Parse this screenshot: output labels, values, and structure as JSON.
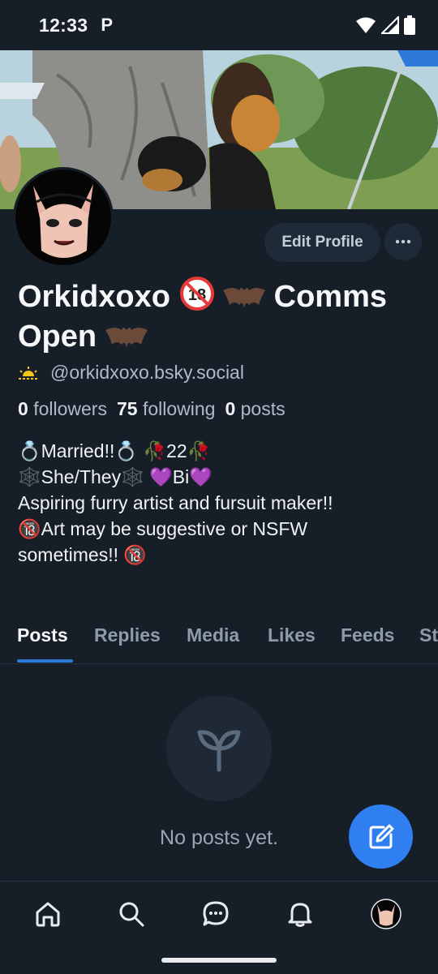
{
  "status_bar": {
    "time": "12:33",
    "notification": "P"
  },
  "profile": {
    "display_name_part1": "Orkidxoxo",
    "display_name_part2": "Comms",
    "display_name_part3": "Open",
    "handle": "@orkidxoxo.bsky.social",
    "followers_count": "0",
    "followers_label": "followers",
    "following_count": "75",
    "following_label": "following",
    "posts_count": "0",
    "posts_label": "posts",
    "bio_lines": [
      "💍Married!!💍 🥀22🥀",
      "🕸️She/They🕸️ 💜Bi💜",
      "Aspiring furry artist and fursuit maker!!",
      "🔞Art may be suggestive or NSFW",
      "sometimes!! 🔞"
    ]
  },
  "actions": {
    "edit_profile": "Edit Profile",
    "more": "···"
  },
  "tabs": [
    "Posts",
    "Replies",
    "Media",
    "Likes",
    "Feeds",
    "St"
  ],
  "empty_state": {
    "message": "No posts yet."
  },
  "nav": [
    "home-icon",
    "search-icon",
    "chat-icon",
    "bell-icon",
    "avatar"
  ],
  "colors": {
    "background": "#161e27",
    "accent": "#2f7ff0",
    "tab_underline": "#2b7bd8"
  }
}
